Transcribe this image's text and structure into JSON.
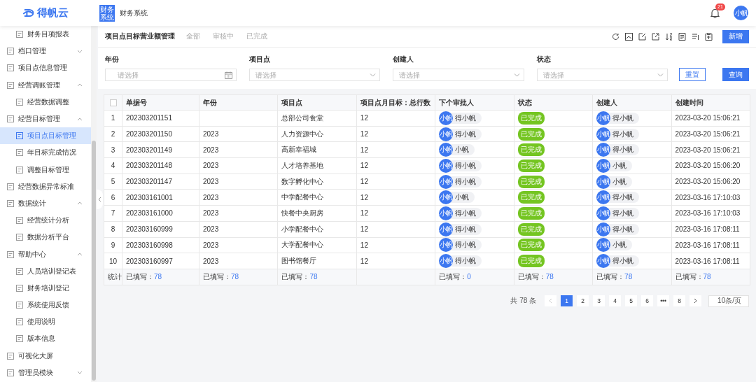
{
  "header": {
    "logo": "得帆云",
    "system_badge": [
      "财务",
      "系统"
    ],
    "system_name": "财务系统",
    "notifications": "21",
    "user_avatar": "小帆"
  },
  "sidebar": {
    "items": [
      {
        "label": "财务目项报表",
        "kind": "child"
      },
      {
        "label": "档口管理",
        "kind": "item",
        "expanded": false
      },
      {
        "label": "项目点信息管理",
        "kind": "item"
      },
      {
        "label": "经营调账管理",
        "kind": "item",
        "expanded": true,
        "children": [
          {
            "label": "经营数据调整",
            "selected": false
          }
        ]
      },
      {
        "label": "经营目标管理",
        "kind": "item",
        "expanded": true,
        "children": [
          {
            "label": "项目点目标管理",
            "selected": true
          },
          {
            "label": "年目标完成情况",
            "selected": false
          },
          {
            "label": "调整目标管理",
            "selected": false
          }
        ]
      },
      {
        "label": "经营数据异常标准",
        "kind": "item"
      },
      {
        "label": "数据统计",
        "kind": "item",
        "expanded": true,
        "children": [
          {
            "label": "经营统计分析",
            "selected": false
          },
          {
            "label": "数据分析平台",
            "selected": false
          }
        ]
      },
      {
        "label": "帮助中心",
        "kind": "item",
        "expanded": true,
        "children": [
          {
            "label": "人员培训登记表",
            "selected": false
          },
          {
            "label": "财务培训登记",
            "selected": false
          },
          {
            "label": "系统使用反馈",
            "selected": false
          },
          {
            "label": "使用说明",
            "selected": false
          },
          {
            "label": "版本信息",
            "selected": false
          }
        ]
      },
      {
        "label": "可视化大屏",
        "kind": "item"
      },
      {
        "label": "管理员模块",
        "kind": "item",
        "expanded": false
      }
    ]
  },
  "page": {
    "title": "项目点目标营业额管理",
    "tabs": [
      {
        "label": "全部",
        "selected": false
      },
      {
        "label": "审核中",
        "selected": false
      },
      {
        "label": "已完成",
        "selected": false
      }
    ],
    "new_button": "新增"
  },
  "filters": [
    {
      "label": "年份",
      "placeholder": "请选择",
      "kind": "date"
    },
    {
      "label": "项目点",
      "placeholder": "请选择",
      "kind": "select"
    },
    {
      "label": "创建人",
      "placeholder": "请选择",
      "kind": "select"
    },
    {
      "label": "状态",
      "placeholder": "请选择",
      "kind": "select"
    }
  ],
  "reset_button": "重置",
  "search_button": "查询",
  "table": {
    "select_all": {
      "checked": false
    },
    "columns": [
      "单据号",
      "年份",
      "项目点",
      "项目点月目标：总行数",
      "下个审批人",
      "状态",
      "创建人",
      "创建时间"
    ],
    "rows": [
      {
        "index": "1",
        "number": "202303201151",
        "site": "总部公司食堂",
        "target": "12",
        "approver": {
          "avatar": "小帆",
          "name": "得小帆"
        },
        "status": "已完成",
        "creator": {
          "avatar": "小帆",
          "name": "得小帆"
        },
        "created": "2023-03-20 15:06:21"
      },
      {
        "index": "2",
        "number": "202303201150",
        "year": "2023",
        "site": "人力资源中心",
        "target": "12",
        "approver": {
          "avatar": "小帆",
          "name": "得小帆"
        },
        "status": "已完成",
        "creator": {
          "avatar": "小帆",
          "name": "得小帆"
        },
        "created": "2023-03-20 15:06:21"
      },
      {
        "index": "3",
        "number": "202303201149",
        "year": "2023",
        "site": "高新幸福城",
        "target": "12",
        "approver": {
          "avatar": "小帆",
          "name": "小帆"
        },
        "status": "已完成",
        "creator": {
          "avatar": "小帆",
          "name": "得小帆"
        },
        "created": "2023-03-20 15:06:21"
      },
      {
        "index": "4",
        "number": "202303201148",
        "year": "2023",
        "site": "人才培养基地",
        "target": "12",
        "approver": {
          "avatar": "小帆",
          "name": "得小帆"
        },
        "status": "已完成",
        "creator": {
          "avatar": "小帆",
          "name": "小帆"
        },
        "created": "2023-03-20 15:06:20"
      },
      {
        "index": "5",
        "number": "202303201147",
        "year": "2023",
        "site": "数字孵化中心",
        "target": "12",
        "approver": {
          "avatar": "小帆",
          "name": "得小帆"
        },
        "status": "已完成",
        "creator": {
          "avatar": "小帆",
          "name": "小帆"
        },
        "created": "2023-03-20 15:06:20"
      },
      {
        "index": "6",
        "number": "202303161001",
        "year": "2023",
        "site": "中学配餐中心",
        "target": "12",
        "approver": {
          "avatar": "小帆",
          "name": "小帆"
        },
        "status": "已完成",
        "creator": {
          "avatar": "小帆",
          "name": "得小帆"
        },
        "created": "2023-03-16 17:10:03"
      },
      {
        "index": "7",
        "number": "202303161000",
        "year": "2023",
        "site": "快餐中央厨房",
        "target": "12",
        "approver": {
          "avatar": "小帆",
          "name": "得小帆"
        },
        "status": "已完成",
        "creator": {
          "avatar": "小帆",
          "name": "得小帆"
        },
        "created": "2023-03-16 17:10:03"
      },
      {
        "index": "8",
        "number": "202303160999",
        "year": "2023",
        "site": "小学配餐中心",
        "target": "12",
        "approver": {
          "avatar": "小帆",
          "name": "得小帆"
        },
        "status": "已完成",
        "creator": {
          "avatar": "小帆",
          "name": "得小帆"
        },
        "created": "2023-03-16 17:08:11"
      },
      {
        "index": "9",
        "number": "202303160998",
        "year": "2023",
        "site": "大学配餐中心",
        "target": "12",
        "approver": {
          "avatar": "小帆",
          "name": "得小帆"
        },
        "status": "已完成",
        "creator": {
          "avatar": "小帆",
          "name": "小帆"
        },
        "created": "2023-03-16 17:08:11"
      },
      {
        "index": "10",
        "number": "202303160997",
        "year": "2023",
        "site": "图书馆餐厅",
        "target": "12",
        "approver": {
          "avatar": "小帆",
          "name": "得小帆"
        },
        "status": "已完成",
        "creator": {
          "avatar": "小帆",
          "name": "得小帆"
        },
        "created": "2023-03-16 17:08:11"
      }
    ],
    "footer": {
      "label": "统计",
      "cells": [
        {
          "label": "已填写：",
          "value": "78"
        },
        {
          "label": "已填写：",
          "value": "78"
        },
        {
          "label": "已填写：",
          "value": "78"
        },
        null,
        {
          "label": "已填写：",
          "value": "0"
        },
        {
          "label": "已填写：",
          "value": "78"
        },
        {
          "label": "已填写：",
          "value": "78"
        },
        {
          "label": "已填写：",
          "value": "78"
        }
      ]
    }
  },
  "pagination": {
    "total": "共 78 条",
    "pages": [
      {
        "label": "1",
        "selected": true
      },
      {
        "label": "2",
        "selected": false
      },
      {
        "label": "3",
        "selected": false
      },
      {
        "label": "4",
        "selected": false
      },
      {
        "label": "5",
        "selected": false
      },
      {
        "label": "6",
        "selected": false
      },
      {
        "label": "•••",
        "selected": false
      },
      {
        "label": "8",
        "selected": false
      }
    ],
    "page_size": "10条/页"
  }
}
